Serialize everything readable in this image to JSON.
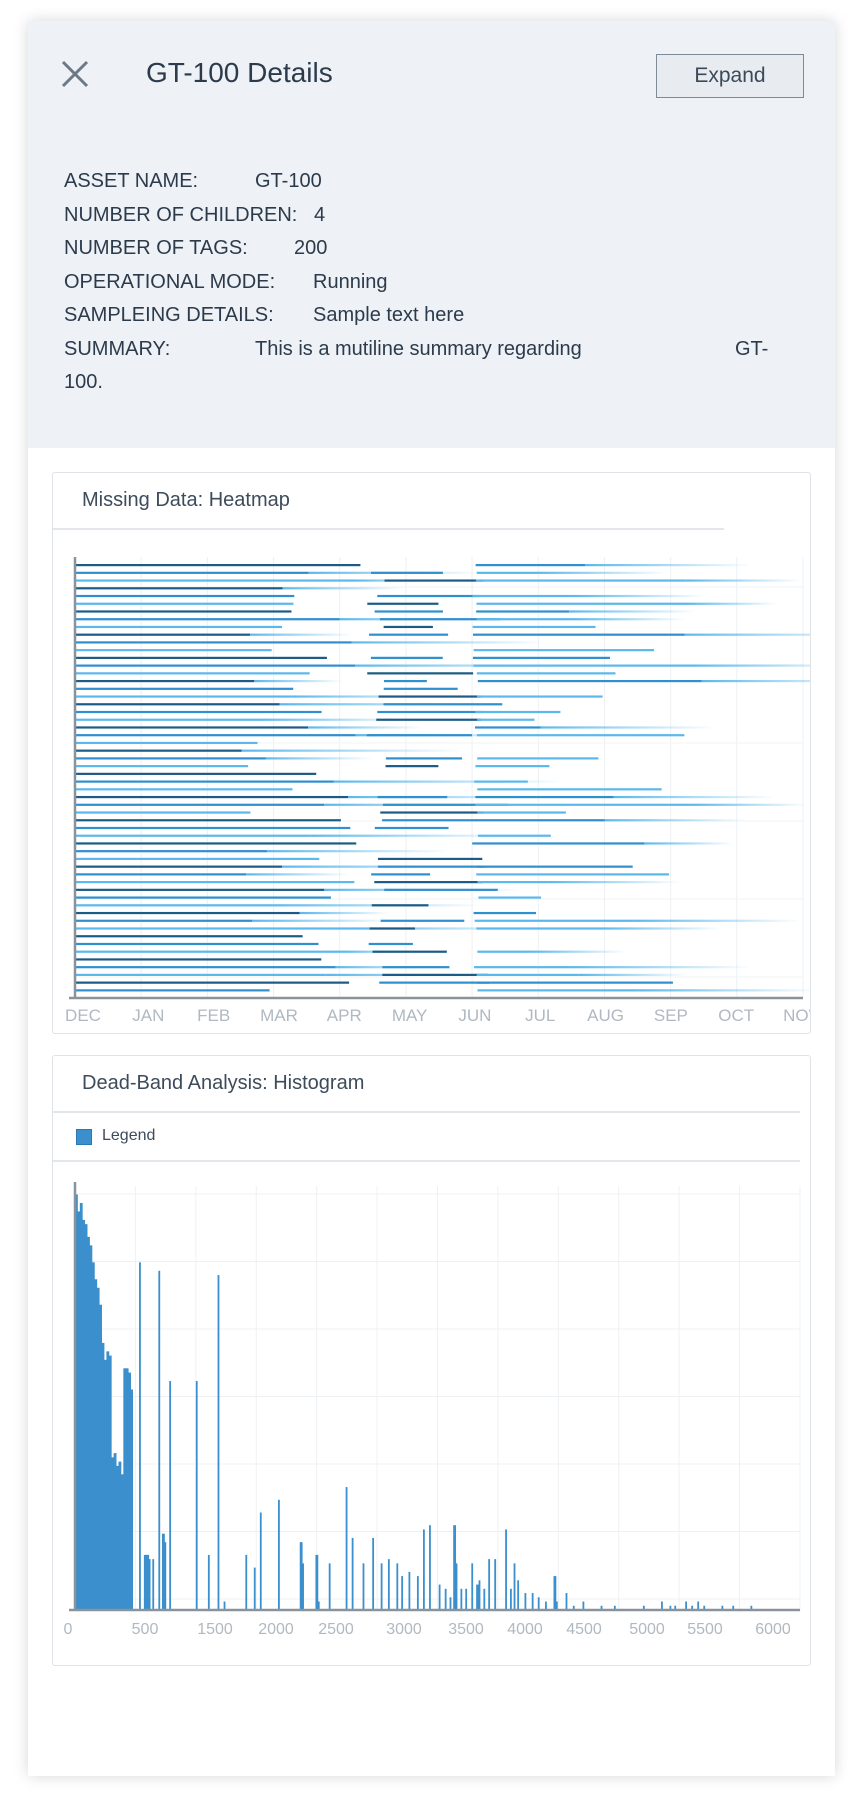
{
  "header": {
    "title": "GT-100 Details",
    "expand_label": "Expand",
    "close_icon": "close-icon"
  },
  "details": [
    {
      "label": "ASSET NAME:",
      "value": "GT-100"
    },
    {
      "label": "NUMBER OF CHILDREN:",
      "value": "4"
    },
    {
      "label": "NUMBER OF TAGS:",
      "value": "200"
    },
    {
      "label": "OPERATIONAL MODE:",
      "value": "Running"
    },
    {
      "label": "SAMPLEING DETAILS:",
      "value": "Sample text here"
    },
    {
      "label": "SUMMARY:",
      "value": "This is a mutiline summary regarding",
      "value_tail": "GT-",
      "continuation": "100."
    }
  ],
  "heatmap_card": {
    "title": "Missing Data: Heatmap"
  },
  "histogram_card": {
    "title": "Dead-Band Analysis: Histogram",
    "legend_label": "Legend"
  },
  "colors": {
    "accent": "#3a8fcc",
    "header_bg": "#eef1f5",
    "dark_bar": "#1b5b86",
    "mid_bar": "#2f8fcf",
    "light_bar": "#5bb8ec"
  },
  "chart_data": [
    {
      "type": "heatmap",
      "title": "Missing Data: Heatmap",
      "x_tick_labels": [
        "DEC",
        "JAN",
        "FEB",
        "MAR",
        "APR",
        "MAY",
        "JUN",
        "JUL",
        "AUG",
        "SEP",
        "OCT",
        "NOV"
      ],
      "grid": true,
      "series": []
    },
    {
      "type": "bar",
      "title": "Dead-Band Analysis: Histogram",
      "xlim": [
        0,
        6000
      ],
      "x_tick_labels": [
        "0",
        "500",
        "1500",
        "2000",
        "2500",
        "3000",
        "3500",
        "4000",
        "4500",
        "5000",
        "5500",
        "6000"
      ],
      "legend": [
        "Legend"
      ],
      "legend_position": "top-left",
      "grid": true,
      "bins": [
        [
          0,
          98
        ],
        [
          20,
          94
        ],
        [
          40,
          96
        ],
        [
          60,
          92
        ],
        [
          80,
          91
        ],
        [
          100,
          88
        ],
        [
          120,
          86
        ],
        [
          140,
          82
        ],
        [
          160,
          78
        ],
        [
          180,
          76
        ],
        [
          200,
          72
        ],
        [
          220,
          63
        ],
        [
          240,
          59
        ],
        [
          260,
          61
        ],
        [
          280,
          60
        ],
        [
          300,
          36
        ],
        [
          320,
          37
        ],
        [
          340,
          34
        ],
        [
          360,
          35
        ],
        [
          380,
          32
        ],
        [
          400,
          57
        ],
        [
          420,
          57
        ],
        [
          440,
          56
        ],
        [
          460,
          52
        ],
        [
          530,
          82
        ],
        [
          570,
          13
        ],
        [
          590,
          13
        ],
        [
          610,
          12
        ],
        [
          640,
          12
        ],
        [
          690,
          80
        ],
        [
          720,
          18
        ],
        [
          740,
          16
        ],
        [
          780,
          54
        ],
        [
          1000,
          54
        ],
        [
          1100,
          13
        ],
        [
          1180,
          79
        ],
        [
          1230,
          2
        ],
        [
          1410,
          13
        ],
        [
          1480,
          10
        ],
        [
          1530,
          23
        ],
        [
          1680,
          26
        ],
        [
          1860,
          16
        ],
        [
          1880,
          11
        ],
        [
          1990,
          13
        ],
        [
          2010,
          2
        ],
        [
          2100,
          11
        ],
        [
          2240,
          29
        ],
        [
          2290,
          17
        ],
        [
          2380,
          11
        ],
        [
          2460,
          17
        ],
        [
          2530,
          11
        ],
        [
          2590,
          12
        ],
        [
          2660,
          11
        ],
        [
          2700,
          8
        ],
        [
          2760,
          9
        ],
        [
          2830,
          8
        ],
        [
          2880,
          19
        ],
        [
          2930,
          20
        ],
        [
          3010,
          6
        ],
        [
          3060,
          5
        ],
        [
          3100,
          3
        ],
        [
          3130,
          20
        ],
        [
          3150,
          11
        ],
        [
          3190,
          5
        ],
        [
          3230,
          5
        ],
        [
          3280,
          11
        ],
        [
          3320,
          6
        ],
        [
          3340,
          7
        ],
        [
          3380,
          5
        ],
        [
          3420,
          12
        ],
        [
          3470,
          12
        ],
        [
          3560,
          19
        ],
        [
          3600,
          5
        ],
        [
          3630,
          11
        ],
        [
          3660,
          7
        ],
        [
          3720,
          4
        ],
        [
          3780,
          4
        ],
        [
          3830,
          3
        ],
        [
          3890,
          2
        ],
        [
          3960,
          8
        ],
        [
          3980,
          2
        ],
        [
          4060,
          4
        ],
        [
          4120,
          1
        ],
        [
          4200,
          2
        ],
        [
          4350,
          1
        ],
        [
          4460,
          1
        ],
        [
          4700,
          1
        ],
        [
          4850,
          2
        ],
        [
          4920,
          1
        ],
        [
          4960,
          1
        ],
        [
          5050,
          2
        ],
        [
          5100,
          1
        ],
        [
          5150,
          2
        ],
        [
          5200,
          1
        ],
        [
          5350,
          1
        ],
        [
          5440,
          1
        ],
        [
          5590,
          1
        ]
      ]
    }
  ]
}
